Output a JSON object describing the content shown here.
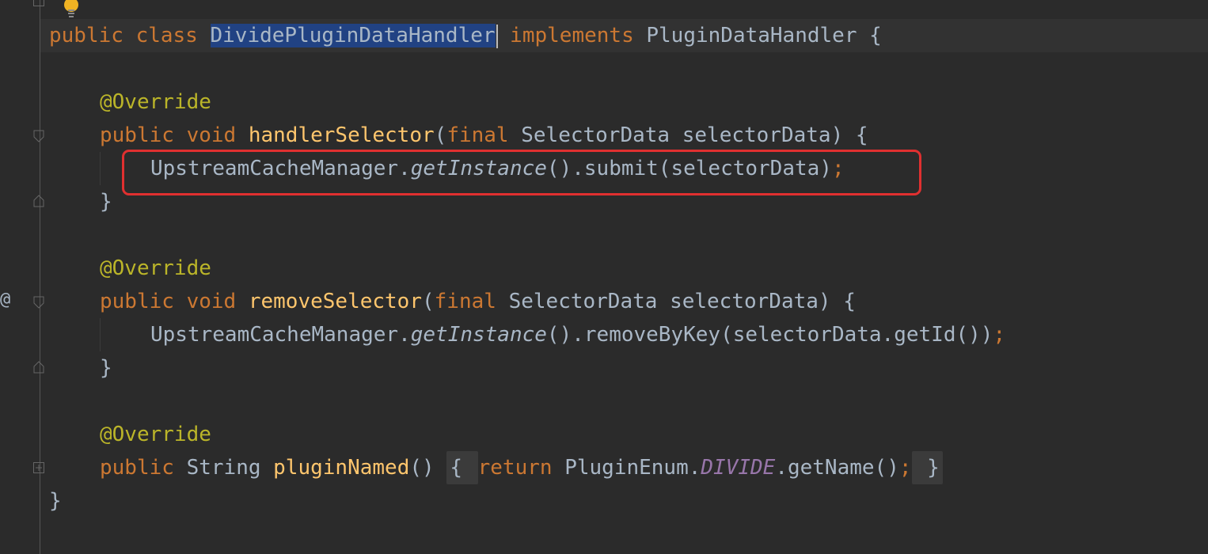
{
  "editor": {
    "lines": [
      {
        "id": "class-decl",
        "tokens": [
          {
            "t": "public class ",
            "c": "kw"
          },
          {
            "t": "DividePluginDataHandler",
            "c": "sel"
          },
          {
            "t": " implements ",
            "c": "kw"
          },
          {
            "t": "PluginDataHandler {",
            "c": ""
          }
        ]
      },
      {
        "id": "override-1",
        "tokens": [
          {
            "t": "@Override",
            "c": "ann"
          }
        ]
      },
      {
        "id": "method-1-sig",
        "tokens": [
          {
            "t": "public void ",
            "c": "kw"
          },
          {
            "t": "handlerSelector",
            "c": "fn"
          },
          {
            "t": "(",
            "c": ""
          },
          {
            "t": "final ",
            "c": "kw"
          },
          {
            "t": "SelectorData selectorData) {",
            "c": ""
          }
        ]
      },
      {
        "id": "method-1-body",
        "tokens": [
          {
            "t": "UpstreamCacheManager.",
            "c": ""
          },
          {
            "t": "getInstance",
            "c": "it"
          },
          {
            "t": "().submit(selectorData)",
            "c": ""
          },
          {
            "t": ";",
            "c": "kw"
          }
        ]
      },
      {
        "id": "method-1-close",
        "tokens": [
          {
            "t": "}",
            "c": ""
          }
        ]
      },
      {
        "id": "override-2",
        "tokens": [
          {
            "t": "@Override",
            "c": "ann"
          }
        ]
      },
      {
        "id": "method-2-sig",
        "tokens": [
          {
            "t": "public void ",
            "c": "kw"
          },
          {
            "t": "removeSelector",
            "c": "fn"
          },
          {
            "t": "(",
            "c": ""
          },
          {
            "t": "final ",
            "c": "kw"
          },
          {
            "t": "SelectorData selectorData) {",
            "c": ""
          }
        ]
      },
      {
        "id": "method-2-body",
        "tokens": [
          {
            "t": "UpstreamCacheManager.",
            "c": ""
          },
          {
            "t": "getInstance",
            "c": "it"
          },
          {
            "t": "().removeByKey(selectorData.getId())",
            "c": ""
          },
          {
            "t": ";",
            "c": "kw"
          }
        ]
      },
      {
        "id": "method-2-close",
        "tokens": [
          {
            "t": "}",
            "c": ""
          }
        ]
      },
      {
        "id": "override-3",
        "tokens": [
          {
            "t": "@Override",
            "c": "ann"
          }
        ]
      },
      {
        "id": "method-3",
        "tokens": [
          {
            "t": "public ",
            "c": "kw"
          },
          {
            "t": "String ",
            "c": ""
          },
          {
            "t": "pluginNamed",
            "c": "fn"
          },
          {
            "t": "() ",
            "c": ""
          },
          {
            "t": "{ ",
            "c": "fold"
          },
          {
            "t": "return ",
            "c": "kw"
          },
          {
            "t": "PluginEnum.",
            "c": ""
          },
          {
            "t": "DIVIDE",
            "c": "const"
          },
          {
            "t": ".getName()",
            "c": ""
          },
          {
            "t": ";",
            "c": "kw"
          },
          {
            "t": " }",
            "c": "fold"
          }
        ]
      },
      {
        "id": "class-close",
        "tokens": [
          {
            "t": "}",
            "c": ""
          }
        ]
      }
    ],
    "gutter_marker": "@"
  },
  "colors": {
    "background": "#2b2b2b",
    "keyword": "#cc7832",
    "annotation": "#bbb529",
    "method": "#ffc66d",
    "constant": "#9876aa",
    "default": "#a9b7c6",
    "selection": "#214283",
    "highlight_box": "#e03030"
  },
  "icons": [
    "lightbulb-icon",
    "fold-icon",
    "implements-marker-icon"
  ]
}
